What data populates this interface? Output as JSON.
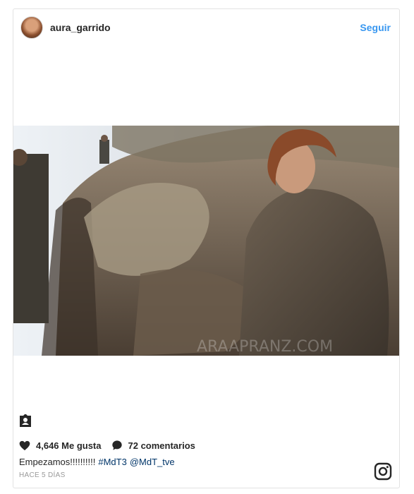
{
  "post": {
    "username": "aura_garrido",
    "follow_label": "Seguir",
    "likes": "4,646 Me gusta",
    "comments": "72 comentarios",
    "caption_text": "Empezamos!!!!!!!!!!",
    "hashtag": "#MdT3",
    "mention": "@MdT_tve",
    "time": "HACE 5 DÍAS",
    "watermark": "ARAAPRANZ.COM"
  },
  "icons": {
    "heart": "heart-icon",
    "comment": "comment-icon",
    "tag": "user-tag-icon",
    "instagram": "instagram-logo-icon"
  },
  "colors": {
    "follow": "#3897f0",
    "link": "#003569",
    "text": "#262626",
    "muted": "#999999"
  }
}
